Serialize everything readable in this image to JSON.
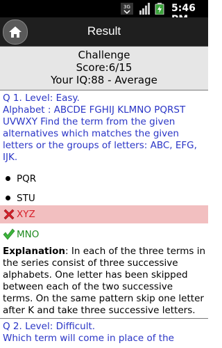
{
  "status_bar": {
    "time": "5:46",
    "ampm": "PM",
    "network": "3G"
  },
  "titlebar": {
    "title": "Result",
    "home_icon": "home-icon"
  },
  "summary": {
    "line1": "Challenge",
    "line2": "Score:6/15",
    "line3": "Your IQ:88 - Average"
  },
  "questions": [
    {
      "heading": "Q 1. Level: Easy.",
      "text": "Alphabet : ABCDE FGHIJ KLMNO PQRST UVWXY Find the term from the given alternatives which matches the given letters or the groups of letters: ABC, EFG, IJK.",
      "options": [
        {
          "label": "PQR",
          "state": "normal"
        },
        {
          "label": "STU",
          "state": "normal"
        },
        {
          "label": "XYZ",
          "state": "wrong"
        },
        {
          "label": "MNO",
          "state": "correct"
        }
      ],
      "explanation_label": "Explanation",
      "explanation_text": ": In each of the three terms in the series consist of three successive alphabets. One letter has been skipped between each of the two successive terms. On the same pattern skip one letter after K and take three successive letters."
    },
    {
      "heading": "Q 2. Level: Difficult.",
      "text": "Which term will come in place of the"
    }
  ],
  "colors": {
    "question": "#2a35c6",
    "wrong_bg": "#f2bfc0",
    "wrong_text": "#d8202a",
    "correct_text": "#1e8a1e"
  }
}
